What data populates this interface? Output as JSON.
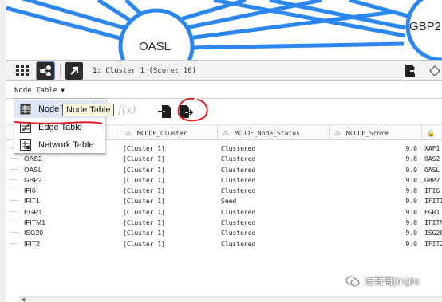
{
  "network": {
    "nodes": [
      {
        "name": "oasl-node",
        "label": "OASL"
      },
      {
        "name": "gbp2-node",
        "label": "GBP2"
      }
    ]
  },
  "toolbar": {
    "cluster_text": "1: Cluster 1 (Score: 10)"
  },
  "table_panel": {
    "title": "Node Table",
    "fx": "f(x)",
    "dropdown": {
      "items": [
        {
          "label": "Node Table",
          "icon": "node-table-icon"
        },
        {
          "label": "Edge Table",
          "icon": "edge-table-icon"
        },
        {
          "label": "Network Table",
          "icon": "network-table-icon"
        }
      ]
    },
    "tooltip": "Node Table",
    "columns": [
      "MCODE_Cluster",
      "MCODE_Node_Status",
      "MCODE_Score"
    ],
    "rows": [
      {
        "name": "",
        "cluster": "[Cluster 1]",
        "status": "Clustered",
        "score": "9.0",
        "last": "XAF1"
      },
      {
        "name": "OAS2",
        "cluster": "[Cluster 1]",
        "status": "Clustered",
        "score": "9.0",
        "last": "OAS2"
      },
      {
        "name": "OASL",
        "cluster": "[Cluster 1]",
        "status": "Clustered",
        "score": "9.0",
        "last": "OASL"
      },
      {
        "name": "GBP2",
        "cluster": "[Cluster 1]",
        "status": "Clustered",
        "score": "9.0",
        "last": "GBP2"
      },
      {
        "name": "IFI6",
        "cluster": "[Cluster 1]",
        "status": "Clustered",
        "score": "9.0",
        "last": "IFI6"
      },
      {
        "name": "IFIT1",
        "cluster": "[Cluster 1]",
        "status": "Seed",
        "score": "9.0",
        "last": "IFIT1"
      },
      {
        "name": "EGR1",
        "cluster": "[Cluster 1]",
        "status": "Clustered",
        "score": "9.0",
        "last": "EGR1"
      },
      {
        "name": "IFITM1",
        "cluster": "[Cluster 1]",
        "status": "Clustered",
        "score": "9.0",
        "last": "IFITM"
      },
      {
        "name": "ISG20",
        "cluster": "[Cluster 1]",
        "status": "Clustered",
        "score": "9.0",
        "last": "ISG20"
      },
      {
        "name": "IFIT2",
        "cluster": "[Cluster 1]",
        "status": "Clustered",
        "score": "9.0",
        "last": "IFIT2"
      }
    ]
  },
  "watermark": "进哥哥Jingle",
  "colors": {
    "node_fill": "#ffffff",
    "node_stroke": "#2b86f0",
    "edge": "#2b86f0",
    "annotation_red": "#e02020"
  }
}
